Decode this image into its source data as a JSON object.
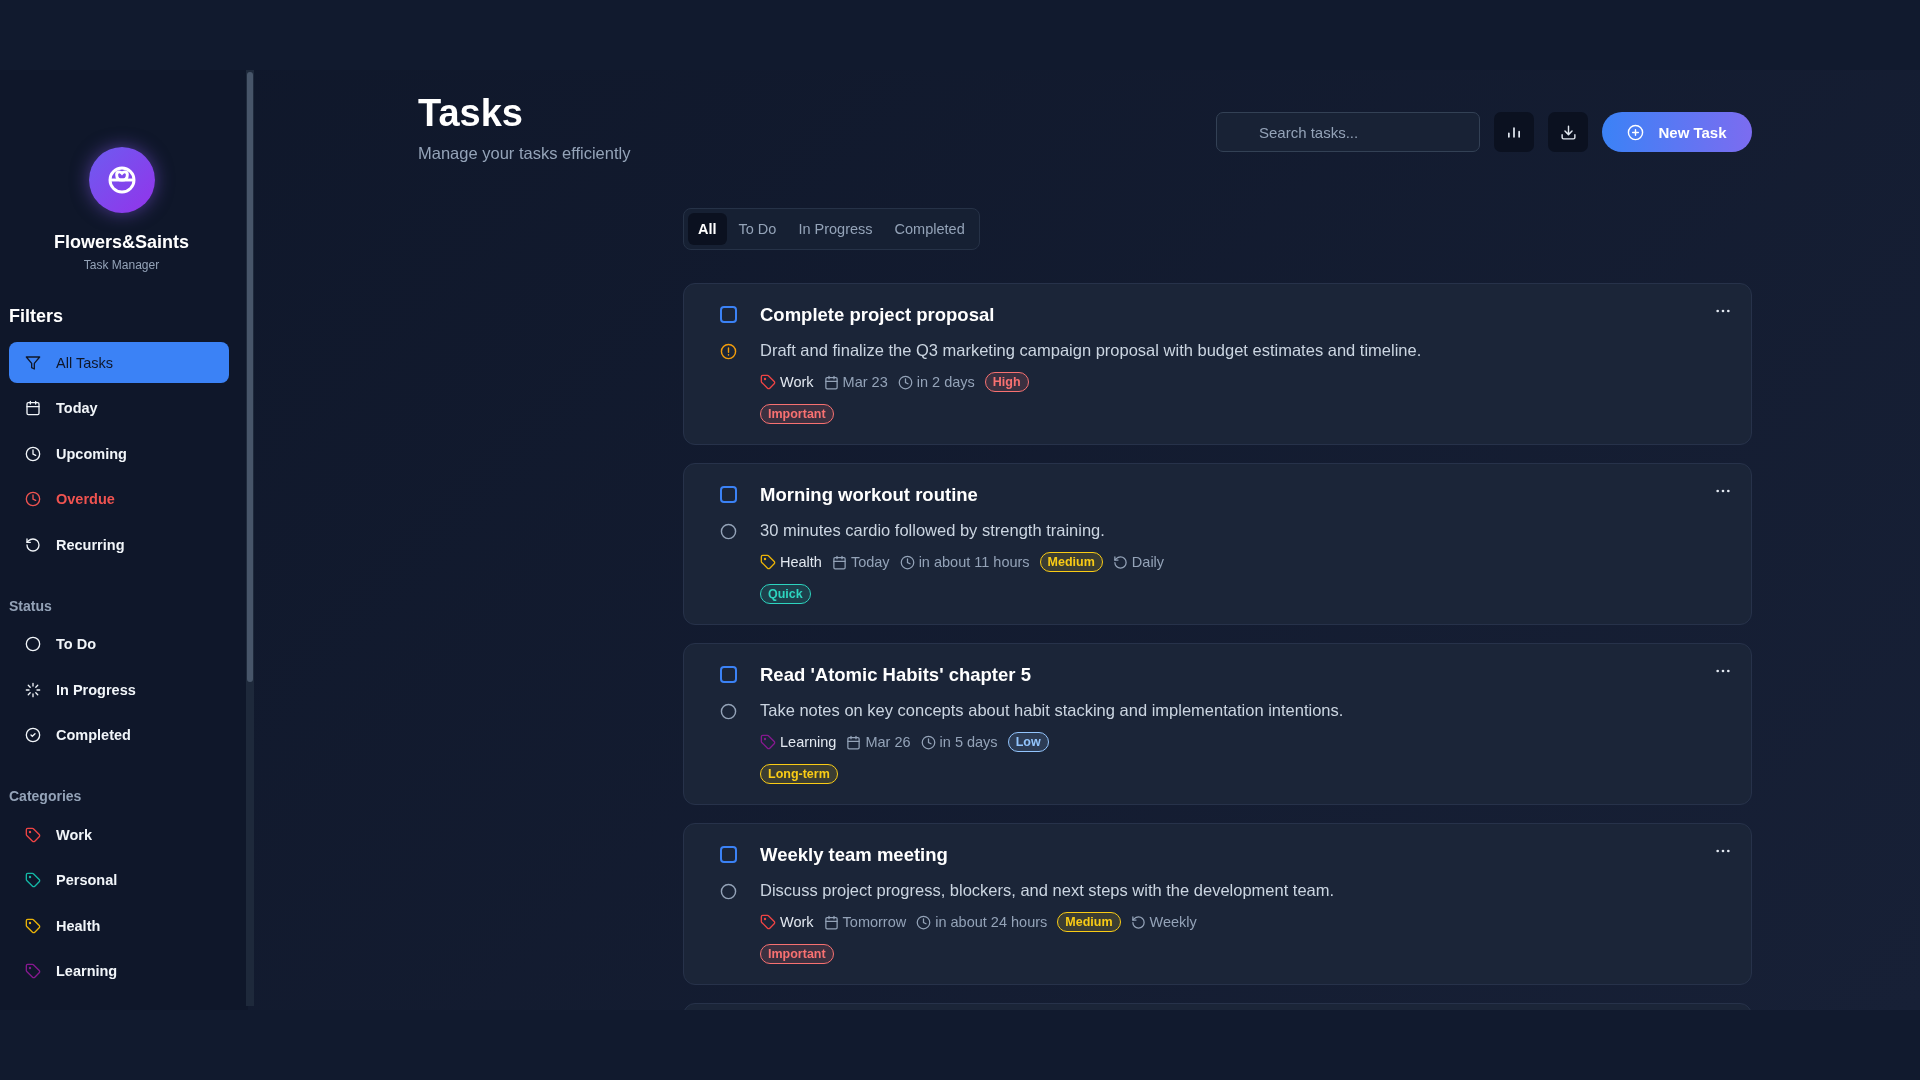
{
  "app": {
    "name": "Flowers&Saints",
    "subtitle": "Task Manager"
  },
  "sidebar": {
    "filters_title": "Filters",
    "filters": [
      {
        "label": "All Tasks",
        "kind": "all",
        "selected": true
      },
      {
        "label": "Today",
        "kind": "today",
        "selected": false
      },
      {
        "label": "Upcoming",
        "kind": "upcoming",
        "selected": false
      },
      {
        "label": "Overdue",
        "kind": "overdue",
        "selected": false
      },
      {
        "label": "Recurring",
        "kind": "recurring",
        "selected": false
      }
    ],
    "status_title": "Status",
    "statuses": [
      {
        "label": "To Do",
        "kind": "todo"
      },
      {
        "label": "In Progress",
        "kind": "in-progress"
      },
      {
        "label": "Completed",
        "kind": "completed"
      }
    ],
    "categories_title": "Categories",
    "categories": [
      {
        "label": "Work",
        "color": "#ef4444"
      },
      {
        "label": "Personal",
        "color": "#14b8a6"
      },
      {
        "label": "Health",
        "color": "#eab308"
      },
      {
        "label": "Learning",
        "color": "#86198f"
      }
    ]
  },
  "header": {
    "title": "Tasks",
    "subtitle": "Manage your tasks efficiently",
    "search": {
      "placeholder": "Search tasks..."
    },
    "new_task_button": "New Task"
  },
  "tabs": [
    {
      "label": "All",
      "selected": true
    },
    {
      "label": "To Do",
      "selected": false
    },
    {
      "label": "In Progress",
      "selected": false
    },
    {
      "label": "Completed",
      "selected": false
    }
  ],
  "tasks": [
    {
      "title": "Complete project proposal",
      "description": "Draft and finalize the Q3 marketing campaign proposal with budget estimates and timeline.",
      "checked": false,
      "overdue": true,
      "category": {
        "label": "Work",
        "color": "#ef4444"
      },
      "date": "Mar 23",
      "due": "in 2 days",
      "priority": {
        "label": "High",
        "color": "#f87171"
      },
      "tags": [
        {
          "label": "Important",
          "color": "#f87171"
        }
      ]
    },
    {
      "title": "Morning workout routine",
      "description": "30 minutes cardio followed by strength training.",
      "checked": false,
      "overdue": false,
      "category": {
        "label": "Health",
        "color": "#eab308"
      },
      "date": "Today",
      "due": "in about 11 hours",
      "priority": {
        "label": "Medium",
        "color": "#facc15"
      },
      "recurrence": "Daily",
      "tags": [
        {
          "label": "Quick",
          "color": "#2dd4bf"
        }
      ]
    },
    {
      "title": "Read 'Atomic Habits' chapter 5",
      "description": "Take notes on key concepts about habit stacking and implementation intentions.",
      "checked": false,
      "overdue": false,
      "category": {
        "label": "Learning",
        "color": "#86198f"
      },
      "date": "Mar 26",
      "due": "in 5 days",
      "priority": {
        "label": "Low",
        "color": "#93c5fd"
      },
      "tags": [
        {
          "label": "Long-term",
          "color": "#facc15"
        }
      ]
    },
    {
      "title": "Weekly team meeting",
      "description": "Discuss project progress, blockers, and next steps with the development team.",
      "checked": false,
      "overdue": false,
      "category": {
        "label": "Work",
        "color": "#ef4444"
      },
      "date": "Tomorrow",
      "due": "in about 24 hours",
      "priority": {
        "label": "Medium",
        "color": "#facc15"
      },
      "recurrence": "Weekly",
      "tags": [
        {
          "label": "Important",
          "color": "#f87171"
        }
      ]
    }
  ]
}
